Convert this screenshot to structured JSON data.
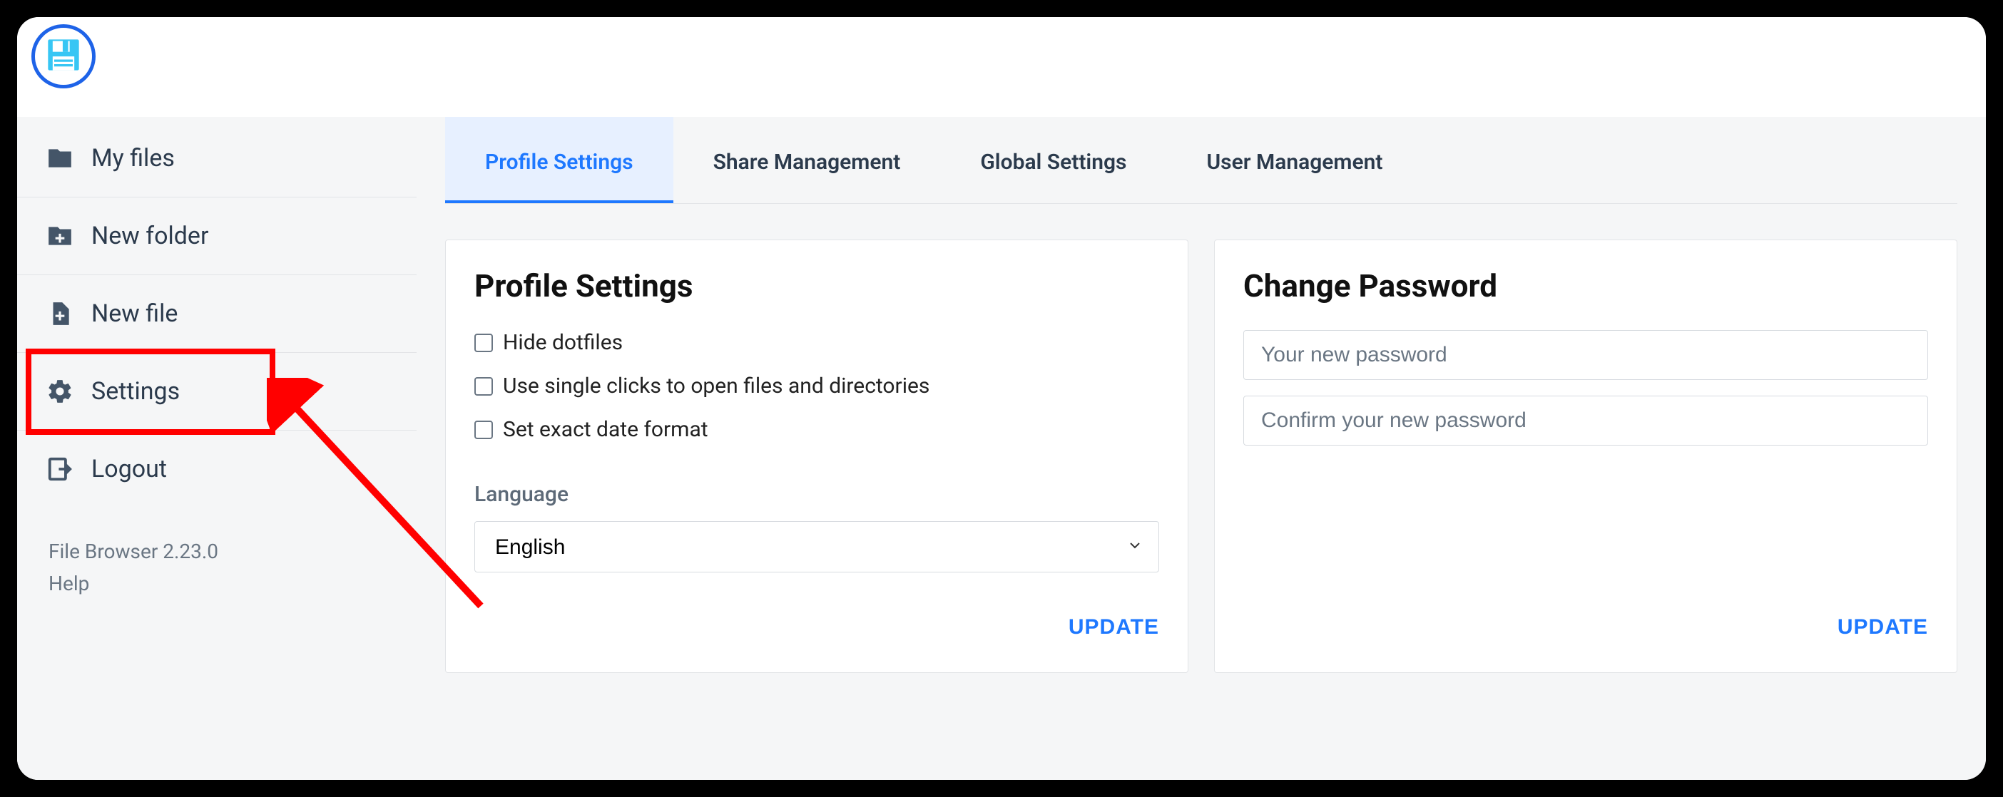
{
  "sidebar": {
    "items": [
      {
        "label": "My files"
      },
      {
        "label": "New folder"
      },
      {
        "label": "New file"
      },
      {
        "label": "Settings"
      },
      {
        "label": "Logout"
      }
    ],
    "highlight_index": 3,
    "footer_version": "File Browser 2.23.0",
    "footer_help": "Help"
  },
  "tabs": [
    {
      "label": "Profile Settings",
      "active": true
    },
    {
      "label": "Share Management",
      "active": false
    },
    {
      "label": "Global Settings",
      "active": false
    },
    {
      "label": "User Management",
      "active": false
    }
  ],
  "profile_card": {
    "title": "Profile Settings",
    "checks": [
      {
        "label": "Hide dotfiles",
        "checked": false
      },
      {
        "label": "Use single clicks to open files and directories",
        "checked": false
      },
      {
        "label": "Set exact date format",
        "checked": false
      }
    ],
    "language_label": "Language",
    "language_value": "English",
    "update_label": "UPDATE"
  },
  "password_card": {
    "title": "Change Password",
    "new_pw_placeholder": "Your new password",
    "confirm_pw_placeholder": "Confirm your new password",
    "update_label": "UPDATE"
  },
  "accent_color": "#1e78ff",
  "highlight_color": "#ff0000"
}
